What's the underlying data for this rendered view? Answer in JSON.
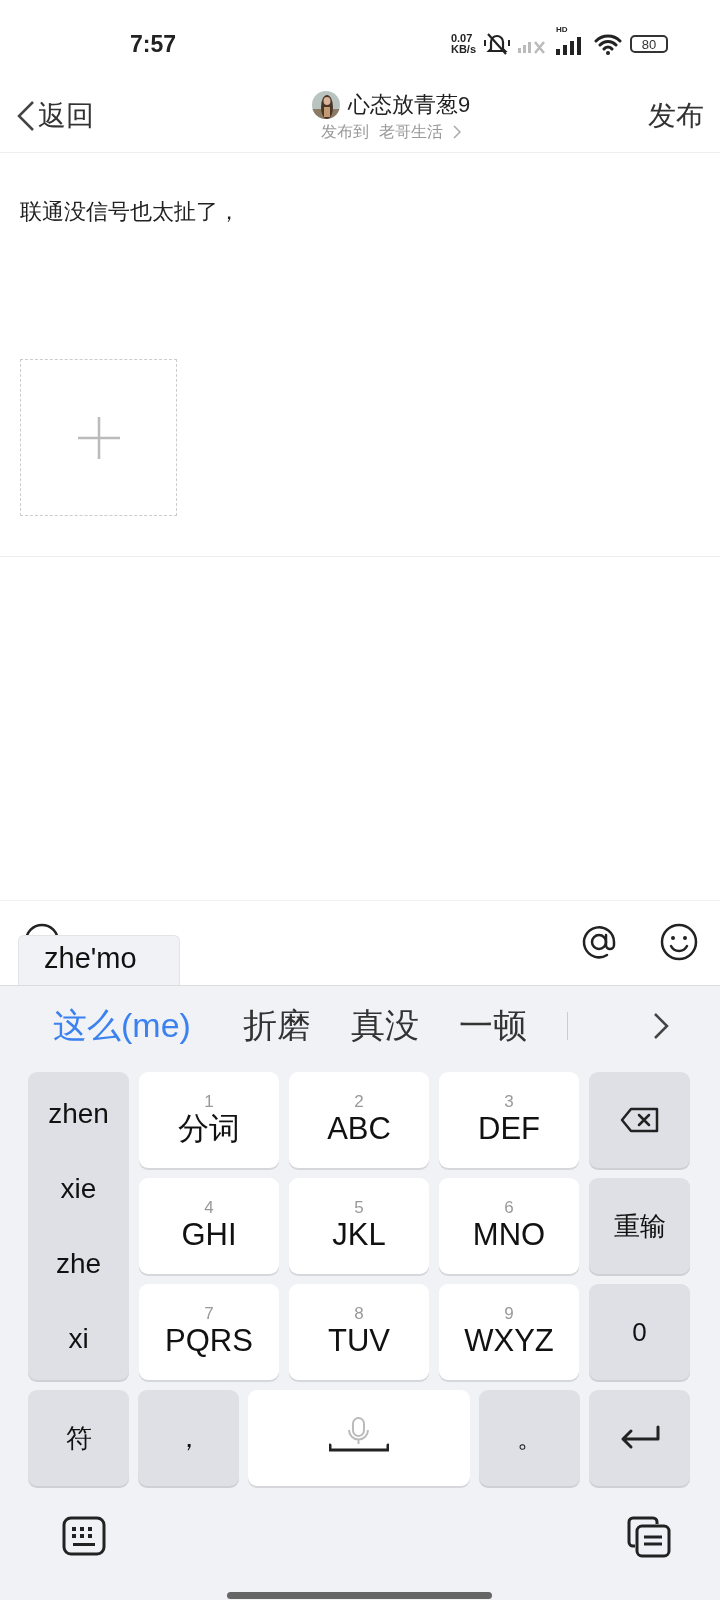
{
  "status_bar": {
    "time": "7:57",
    "net_speed": [
      "0.07",
      "KB/s"
    ],
    "signal_badge": "HD",
    "battery": "80"
  },
  "header": {
    "back": "返回",
    "username": "心态放青葱9",
    "subtitle": "发布到",
    "channel": "老哥生活",
    "publish": "发布"
  },
  "post": {
    "text": "联通没信号也太扯了，"
  },
  "ime": {
    "composition": "zhe'mo",
    "candidates": [
      {
        "text": "这么(me)",
        "selected": true
      },
      {
        "text": "折磨",
        "selected": false
      },
      {
        "text": "真没",
        "selected": false
      },
      {
        "text": "一顿",
        "selected": false
      }
    ],
    "pinyin_options": [
      "zhen",
      "xie",
      "zhe",
      "xi"
    ],
    "keys": [
      {
        "kind": "t9",
        "digit": "1",
        "label": "分词"
      },
      {
        "kind": "t9",
        "digit": "2",
        "label": "ABC"
      },
      {
        "kind": "t9",
        "digit": "3",
        "label": "DEF"
      },
      {
        "kind": "delete"
      },
      {
        "kind": "t9",
        "digit": "4",
        "label": "GHI"
      },
      {
        "kind": "t9",
        "digit": "5",
        "label": "JKL"
      },
      {
        "kind": "t9",
        "digit": "6",
        "label": "MNO"
      },
      {
        "kind": "gray",
        "label": "重输"
      },
      {
        "kind": "t9",
        "digit": "7",
        "label": "PQRS"
      },
      {
        "kind": "t9",
        "digit": "8",
        "label": "TUV"
      },
      {
        "kind": "t9",
        "digit": "9",
        "label": "WXYZ"
      },
      {
        "kind": "gray",
        "label": "0"
      }
    ],
    "bottom_keys": [
      {
        "kind": "gray",
        "label": "符"
      },
      {
        "kind": "gray",
        "label": "，"
      },
      {
        "kind": "space"
      },
      {
        "kind": "gray",
        "label": "。"
      },
      {
        "kind": "enter"
      }
    ]
  }
}
